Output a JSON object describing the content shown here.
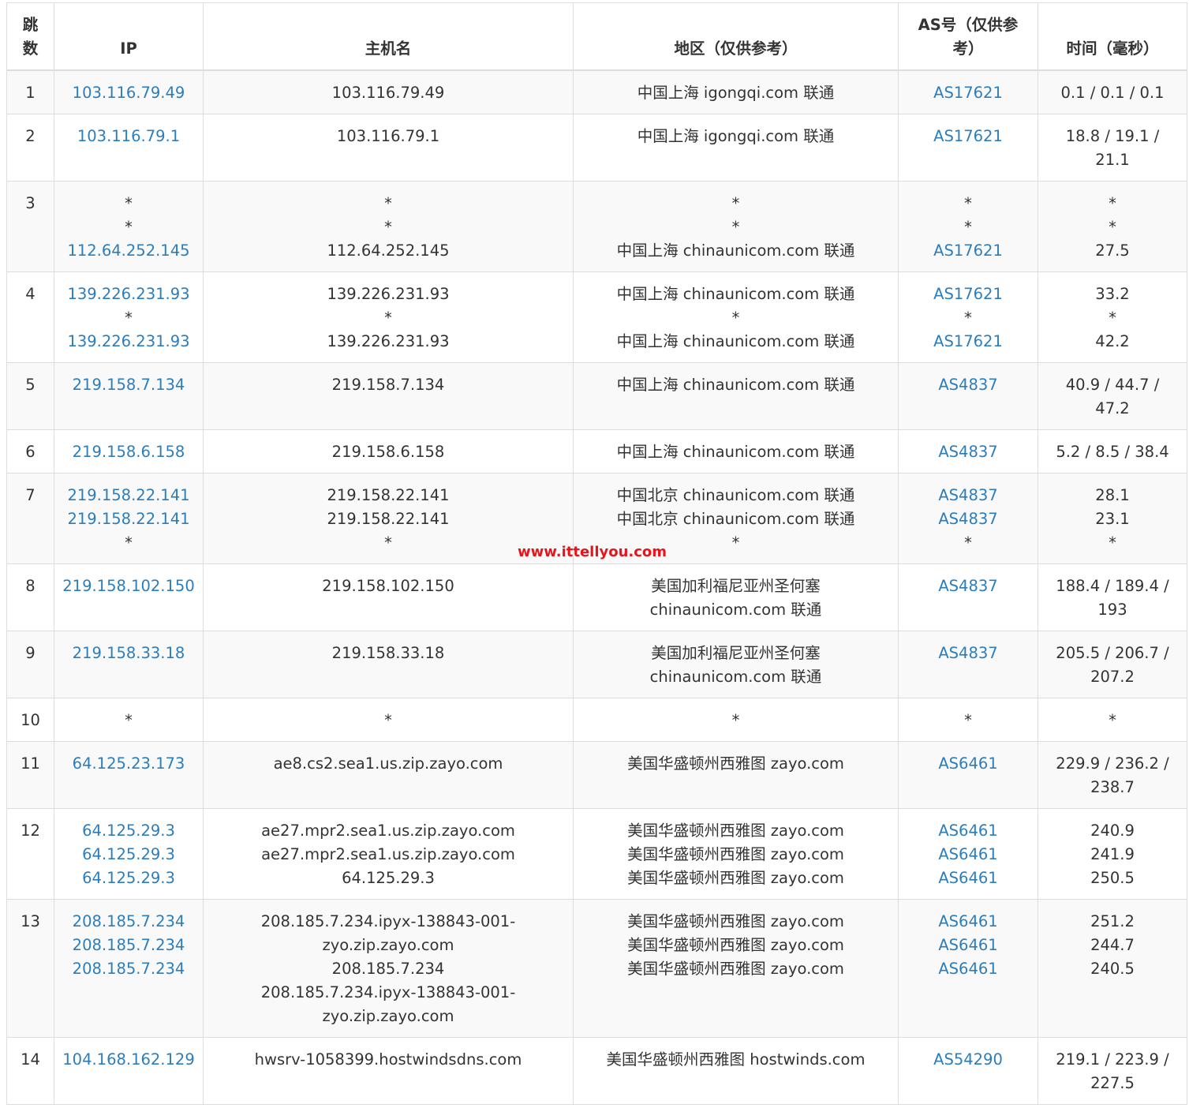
{
  "colors": {
    "text": "#333333",
    "link": "#2b7dbc",
    "border": "#dddddd",
    "stripe": "#f9f9f9",
    "watermark": "#e8141b"
  },
  "watermark": "www.ittellyou.com",
  "headers": {
    "hop": [
      "跳",
      "数"
    ],
    "ip": [
      "IP"
    ],
    "host": [
      "主机名"
    ],
    "region": [
      "地区（仅供参考）"
    ],
    "asn": [
      "AS号（仅供参",
      "考）"
    ],
    "time": [
      "时间（毫秒）"
    ]
  },
  "rows": [
    {
      "hop": "1",
      "ip": [
        "103.116.79.49"
      ],
      "host": [
        "103.116.79.49"
      ],
      "region": [
        "中国上海 igongqi.com 联通"
      ],
      "asn": [
        "AS17621"
      ],
      "time": [
        "0.1 / 0.1 / 0.1"
      ]
    },
    {
      "hop": "2",
      "ip": [
        "103.116.79.1"
      ],
      "host": [
        "103.116.79.1"
      ],
      "region": [
        "中国上海 igongqi.com 联通"
      ],
      "asn": [
        "AS17621"
      ],
      "time": [
        "18.8 / 19.1 /",
        "21.1"
      ]
    },
    {
      "hop": "3",
      "ip": [
        "*",
        "*",
        "112.64.252.145"
      ],
      "host": [
        "*",
        "*",
        "112.64.252.145"
      ],
      "region": [
        "*",
        "*",
        "中国上海 chinaunicom.com 联通"
      ],
      "asn": [
        "*",
        "*",
        "AS17621"
      ],
      "time": [
        "*",
        "*",
        "27.5"
      ]
    },
    {
      "hop": "4",
      "ip": [
        "139.226.231.93",
        "*",
        "139.226.231.93"
      ],
      "host": [
        "139.226.231.93",
        "*",
        "139.226.231.93"
      ],
      "region": [
        "中国上海 chinaunicom.com 联通",
        "*",
        "中国上海 chinaunicom.com 联通"
      ],
      "asn": [
        "AS17621",
        "*",
        "AS17621"
      ],
      "time": [
        "33.2",
        "*",
        "42.2"
      ]
    },
    {
      "hop": "5",
      "ip": [
        "219.158.7.134"
      ],
      "host": [
        "219.158.7.134"
      ],
      "region": [
        "中国上海 chinaunicom.com 联通"
      ],
      "asn": [
        "AS4837"
      ],
      "time": [
        "40.9 / 44.7 /",
        "47.2"
      ]
    },
    {
      "hop": "6",
      "ip": [
        "219.158.6.158"
      ],
      "host": [
        "219.158.6.158"
      ],
      "region": [
        "中国上海 chinaunicom.com 联通"
      ],
      "asn": [
        "AS4837"
      ],
      "time": [
        "5.2 / 8.5 / 38.4"
      ]
    },
    {
      "hop": "7",
      "ip": [
        "219.158.22.141",
        "219.158.22.141",
        "*"
      ],
      "host": [
        "219.158.22.141",
        "219.158.22.141",
        "*"
      ],
      "region": [
        "中国北京 chinaunicom.com 联通",
        "中国北京 chinaunicom.com 联通",
        "*"
      ],
      "asn": [
        "AS4837",
        "AS4837",
        "*"
      ],
      "time": [
        "28.1",
        "23.1",
        "*"
      ]
    },
    {
      "hop": "8",
      "ip": [
        "219.158.102.150"
      ],
      "host": [
        "219.158.102.150"
      ],
      "region": [
        "美国加利福尼亚州圣何塞",
        "chinaunicom.com 联通"
      ],
      "asn": [
        "AS4837"
      ],
      "time": [
        "188.4 / 189.4 /",
        "193"
      ]
    },
    {
      "hop": "9",
      "ip": [
        "219.158.33.18"
      ],
      "host": [
        "219.158.33.18"
      ],
      "region": [
        "美国加利福尼亚州圣何塞",
        "chinaunicom.com 联通"
      ],
      "asn": [
        "AS4837"
      ],
      "time": [
        "205.5 / 206.7 /",
        "207.2"
      ]
    },
    {
      "hop": "10",
      "ip": [
        "*"
      ],
      "host": [
        "*"
      ],
      "region": [
        "*"
      ],
      "asn": [
        "*"
      ],
      "time": [
        "*"
      ]
    },
    {
      "hop": "11",
      "ip": [
        "64.125.23.173"
      ],
      "host": [
        "ae8.cs2.sea1.us.zip.zayo.com"
      ],
      "region": [
        "美国华盛顿州西雅图 zayo.com"
      ],
      "asn": [
        "AS6461"
      ],
      "time": [
        "229.9 / 236.2 /",
        "238.7"
      ]
    },
    {
      "hop": "12",
      "ip": [
        "64.125.29.3",
        "64.125.29.3",
        "64.125.29.3"
      ],
      "host": [
        "ae27.mpr2.sea1.us.zip.zayo.com",
        "ae27.mpr2.sea1.us.zip.zayo.com",
        "64.125.29.3"
      ],
      "region": [
        "美国华盛顿州西雅图 zayo.com",
        "美国华盛顿州西雅图 zayo.com",
        "美国华盛顿州西雅图 zayo.com"
      ],
      "asn": [
        "AS6461",
        "AS6461",
        "AS6461"
      ],
      "time": [
        "240.9",
        "241.9",
        "250.5"
      ]
    },
    {
      "hop": "13",
      "ip": [
        "208.185.7.234",
        "208.185.7.234",
        "208.185.7.234"
      ],
      "host": [
        "208.185.7.234.ipyx-138843-001-",
        "zyo.zip.zayo.com",
        "208.185.7.234",
        "208.185.7.234.ipyx-138843-001-",
        "zyo.zip.zayo.com"
      ],
      "region": [
        "美国华盛顿州西雅图 zayo.com",
        "美国华盛顿州西雅图 zayo.com",
        "美国华盛顿州西雅图 zayo.com"
      ],
      "asn": [
        "AS6461",
        "AS6461",
        "AS6461"
      ],
      "time": [
        "251.2",
        "244.7",
        "240.5"
      ]
    },
    {
      "hop": "14",
      "ip": [
        "104.168.162.129"
      ],
      "host": [
        "hwsrv-1058399.hostwindsdns.com"
      ],
      "region": [
        "美国华盛顿州西雅图 hostwinds.com"
      ],
      "asn": [
        "AS54290"
      ],
      "time": [
        "219.1 / 223.9 /",
        "227.5"
      ]
    }
  ]
}
